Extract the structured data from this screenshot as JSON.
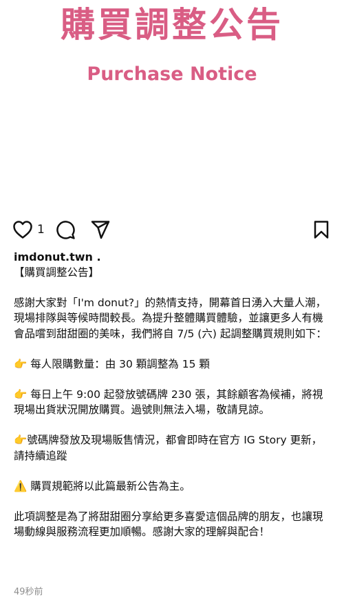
{
  "colors": {
    "headline": "#d95d84",
    "text": "#111111",
    "muted": "#8e8e8e"
  },
  "post_image": {
    "headline_zh": "購買調整公告",
    "headline_en": "Purchase Notice"
  },
  "actions": {
    "like_icon": "heart-icon",
    "like_count": "1",
    "comment_icon": "comment-bubble-icon",
    "share_icon": "paper-plane-icon",
    "save_icon": "bookmark-icon"
  },
  "caption": {
    "username": "imdonut.twn .",
    "title": "【購買調整公告】",
    "paragraphs": [
      "感謝大家對「I'm donut?」的熱情支持，開幕首日湧入大量人潮，現場排隊與等候時間較長。為提升整體購買體驗，並讓更多人有機會品嚐到甜甜圈的美味，我們將自 7/5 (六) 起調整購買規則如下：",
      "👉 每人限購數量：由 30 顆調整為 15 顆",
      "👉 每日上午 9:00 起發放號碼牌 230 張，其餘顧客為候補，將視現場出貨狀況開放購買。過號則無法入場，敬請見諒。",
      "👉號碼牌發放及現場販售情況，都會即時在官方 IG Story 更新，請持續追蹤",
      "⚠️ 購買規範將以此篇最新公告為主。",
      "此項調整是為了將甜甜圈分享給更多喜愛這個品牌的朋友，也讓現場動線與服務流程更加順暢。感謝大家的理解與配合！"
    ]
  },
  "timestamp": "49秒前"
}
